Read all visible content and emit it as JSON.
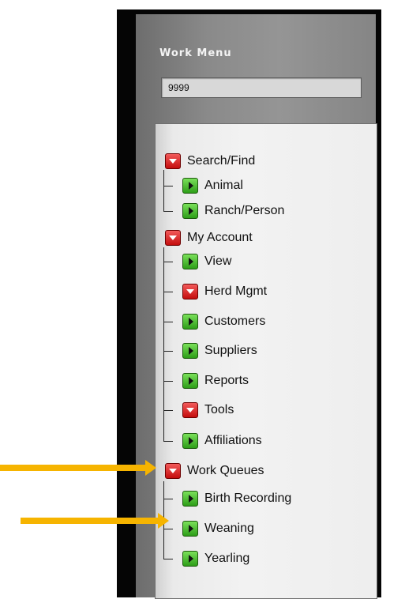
{
  "menu": {
    "title": "Work Menu",
    "input_value": "9999",
    "groups": [
      {
        "label": "Search/Find",
        "icon": "collapse-icon",
        "items": [
          {
            "label": "Animal",
            "icon": "expand-icon"
          },
          {
            "label": "Ranch/Person",
            "icon": "expand-icon"
          }
        ]
      },
      {
        "label": "My Account",
        "icon": "collapse-icon",
        "items": [
          {
            "label": "View",
            "icon": "expand-icon"
          },
          {
            "label": "Herd Mgmt",
            "icon": "collapse-icon"
          },
          {
            "label": "Customers",
            "icon": "expand-icon"
          },
          {
            "label": "Suppliers",
            "icon": "expand-icon"
          },
          {
            "label": "Reports",
            "icon": "expand-icon"
          },
          {
            "label": "Tools",
            "icon": "collapse-icon"
          },
          {
            "label": "Affiliations",
            "icon": "expand-icon"
          }
        ]
      },
      {
        "label": "Work Queues",
        "icon": "collapse-icon",
        "items": [
          {
            "label": "Birth Recording",
            "icon": "expand-icon"
          },
          {
            "label": "Weaning",
            "icon": "expand-icon"
          },
          {
            "label": "Yearling",
            "icon": "expand-icon"
          }
        ]
      }
    ]
  },
  "colors": {
    "collapse": "#d01818",
    "expand": "#3cb028",
    "annotation_arrow": "#f6b400",
    "panel_frame": "#050505"
  }
}
